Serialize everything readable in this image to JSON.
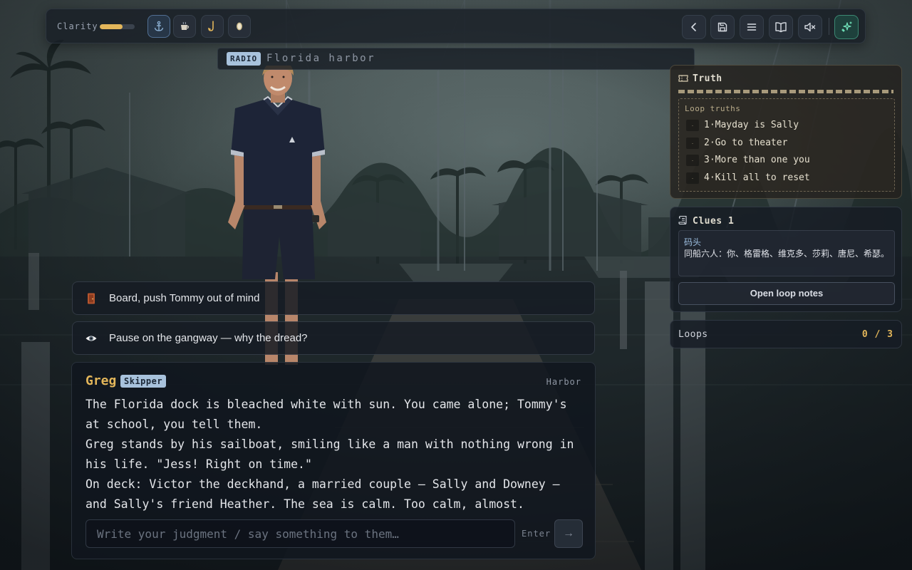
{
  "app": {
    "accent": "#e3b65a",
    "tag_color": "#a8c2dc"
  },
  "topbar": {
    "clarity_label": "Clarity",
    "clarity_level": 0.65,
    "inventory": [
      {
        "icon": "anchor-icon",
        "glyph": "⚓",
        "active": true
      },
      {
        "icon": "coffee-cup-icon",
        "glyph": "☕",
        "active": false
      },
      {
        "icon": "fishing-hook-icon",
        "glyph": "🪝",
        "active": false
      },
      {
        "icon": "pocket-watch-icon",
        "glyph": "⌚",
        "active": false
      }
    ],
    "buttons": [
      "back-icon",
      "save-icon",
      "menu-icon",
      "journal-icon",
      "mute-icon",
      "sparkle-icon"
    ]
  },
  "location": {
    "tag": "RADIO",
    "name": "Florida harbor"
  },
  "choices": [
    {
      "icon": "door-icon",
      "glyph": "🚪",
      "label": "Board, push Tommy out of mind"
    },
    {
      "icon": "eye-icon",
      "glyph": "👁",
      "label": "Pause on the gangway — why the dread?"
    }
  ],
  "dialogue": {
    "speaker": "Greg",
    "role": "Skipper",
    "scene": "Harbor",
    "lines": [
      "The Florida dock is bleached white with sun. You came alone; Tommy's at school, you tell them.",
      "Greg stands by his sailboat, smiling like a man with nothing wrong in his life. \"Jess! Right on time.\"",
      "On deck: Victor the deckhand, a married couple — Sally and Downey — and Sally's friend Heather. The sea is calm. Too calm, almost."
    ],
    "input_placeholder": "Write your judgment / say something to them…",
    "enter_hint": "Enter",
    "send_glyph": "→"
  },
  "truth": {
    "title": "Truth",
    "loop_title": "Loop truths",
    "bullet": "·",
    "items": [
      "1·Mayday is Sally",
      "2·Go to theater",
      "3·More than one you",
      "4·Kill all to reset"
    ]
  },
  "clues": {
    "title": "Clues 1",
    "card_title": "码头",
    "card_body": "同船六人：你、格雷格、维克多、莎莉、唐尼、希瑟。",
    "open_notes_label": "Open loop notes"
  },
  "loops": {
    "label": "Loops",
    "value": "0 / 3"
  }
}
